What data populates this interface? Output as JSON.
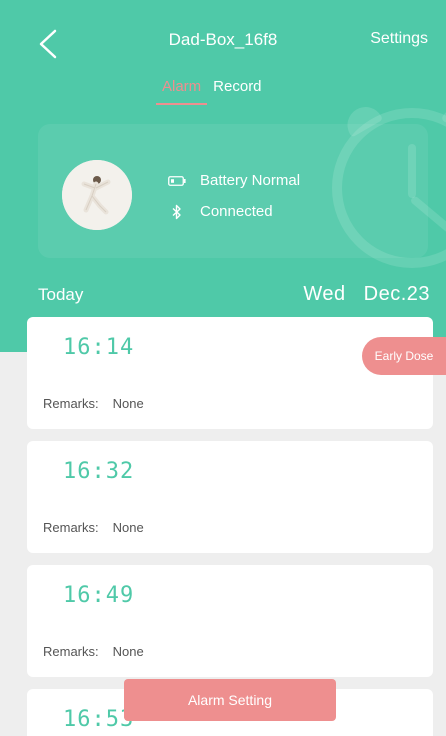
{
  "header": {
    "title": "Dad-Box_16f8",
    "settings_label": "Settings",
    "tabs": [
      {
        "label": "Alarm",
        "active": true
      },
      {
        "label": "Record",
        "active": false
      }
    ]
  },
  "device": {
    "battery_status": "Battery Normal",
    "connection_status": "Connected"
  },
  "date_bar": {
    "today_label": "Today",
    "weekday": "Wed",
    "date": "Dec.23"
  },
  "alarms": [
    {
      "time": "16:14",
      "remarks_label": "Remarks:",
      "remarks_value": "None"
    },
    {
      "time": "16:32",
      "remarks_label": "Remarks:",
      "remarks_value": "None"
    },
    {
      "time": "16:49",
      "remarks_label": "Remarks:",
      "remarks_value": "None"
    },
    {
      "time": "16:53"
    }
  ],
  "early_dose_label": "Early Dose",
  "alarm_setting_label": "Alarm Setting",
  "colors": {
    "primary": "#4fc9a8",
    "accent": "#ee8f8f",
    "background": "#eeeeee"
  },
  "icons": [
    "back-arrow-icon",
    "battery-icon",
    "bluetooth-icon",
    "alarm-clock-icon"
  ]
}
